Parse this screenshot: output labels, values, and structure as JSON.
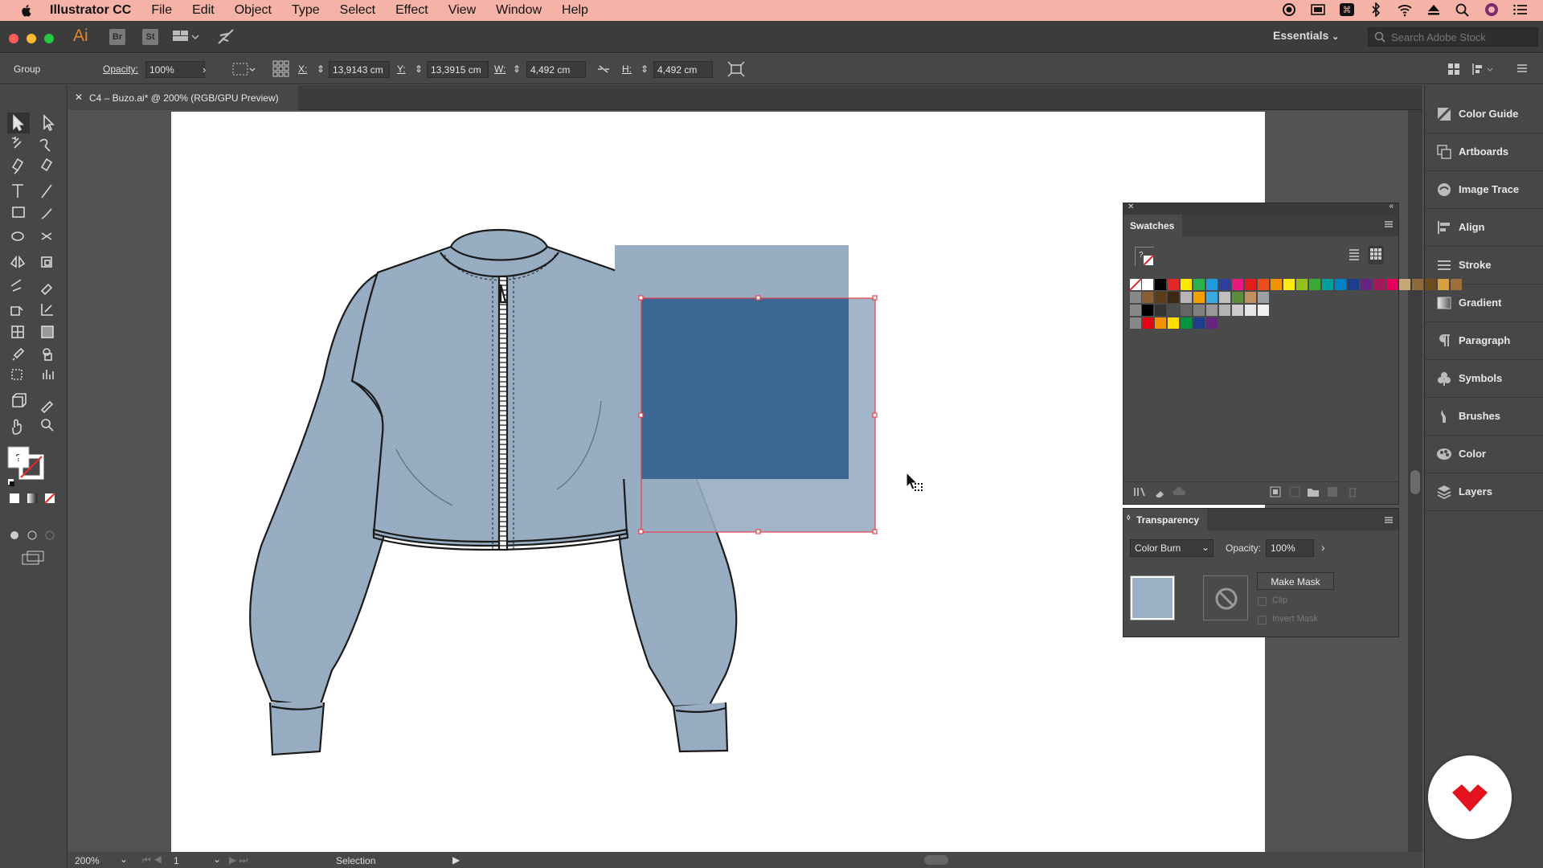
{
  "menubar": {
    "app_name": "Illustrator CC",
    "items": [
      "File",
      "Edit",
      "Object",
      "Type",
      "Select",
      "Effect",
      "View",
      "Window",
      "Help"
    ]
  },
  "appbar": {
    "logo": "Ai",
    "bridge": "Br",
    "stock": "St",
    "workspace": "Essentials",
    "search_placeholder": "Search Adobe Stock"
  },
  "control": {
    "selection_type": "Group",
    "opacity_label": "Opacity:",
    "opacity_value": "100%",
    "x_label": "X:",
    "x_value": "13,9143 cm",
    "y_label": "Y:",
    "y_value": "13,3915 cm",
    "w_label": "W:",
    "w_value": "4,492 cm",
    "h_label": "H:",
    "h_value": "4,492 cm"
  },
  "document": {
    "tab_title": "C4 – Buzo.ai* @ 200% (RGB/GPU Preview)"
  },
  "status": {
    "zoom": "200%",
    "artboard_number": "1",
    "tool_name": "Selection"
  },
  "dock": {
    "items": [
      "Color Guide",
      "Artboards",
      "Image Trace",
      "Align",
      "Stroke",
      "Gradient",
      "Paragraph",
      "Symbols",
      "Brushes",
      "Color",
      "Layers"
    ]
  },
  "swatches": {
    "title": "Swatches",
    "row1": [
      "#ffffff",
      "#000000",
      "#e22828",
      "#ffe800",
      "#2bb24c",
      "#1e9be0",
      "#2d3f9a",
      "#e6197f",
      "#e21c1c",
      "#e94e1b",
      "#f39200",
      "#fcea10",
      "#95c11f",
      "#3aaa35",
      "#00a19a",
      "#0082c9",
      "#1d3e8e",
      "#662483",
      "#a3195b",
      "#e5005b",
      "#c6a875",
      "#8f6b3c",
      "#6d4c1f",
      "#d9a03f",
      "#9c6f3b"
    ],
    "row2": [
      "#8b5e34",
      "#5c3c1b",
      "#3d2813",
      "#b6b6b6",
      "#f4a000",
      "#3aa9e0",
      "#bfbfbf",
      "#5d8c3a",
      "#c09060",
      "#9aa0a6"
    ],
    "row3": [
      "#000000",
      "#333333",
      "#4d4d4d",
      "#666666",
      "#808080",
      "#999999",
      "#b3b3b3",
      "#cccccc",
      "#e6e6e6",
      "#f2f2f2"
    ],
    "row4": [
      "#e30613",
      "#f39200",
      "#ffde00",
      "#009640",
      "#1d3e8e",
      "#662483"
    ]
  },
  "transparency": {
    "title": "Transparency",
    "blend_mode": "Color Burn",
    "opacity_label": "Opacity:",
    "opacity_value": "100%",
    "make_mask": "Make Mask",
    "clip": "Clip",
    "invert_mask": "Invert Mask"
  },
  "colors": {
    "denim_light": "#9aafc4",
    "denim_dark": "#3e6a98",
    "selection": "#e8404a",
    "brand_red": "#e4121c"
  }
}
